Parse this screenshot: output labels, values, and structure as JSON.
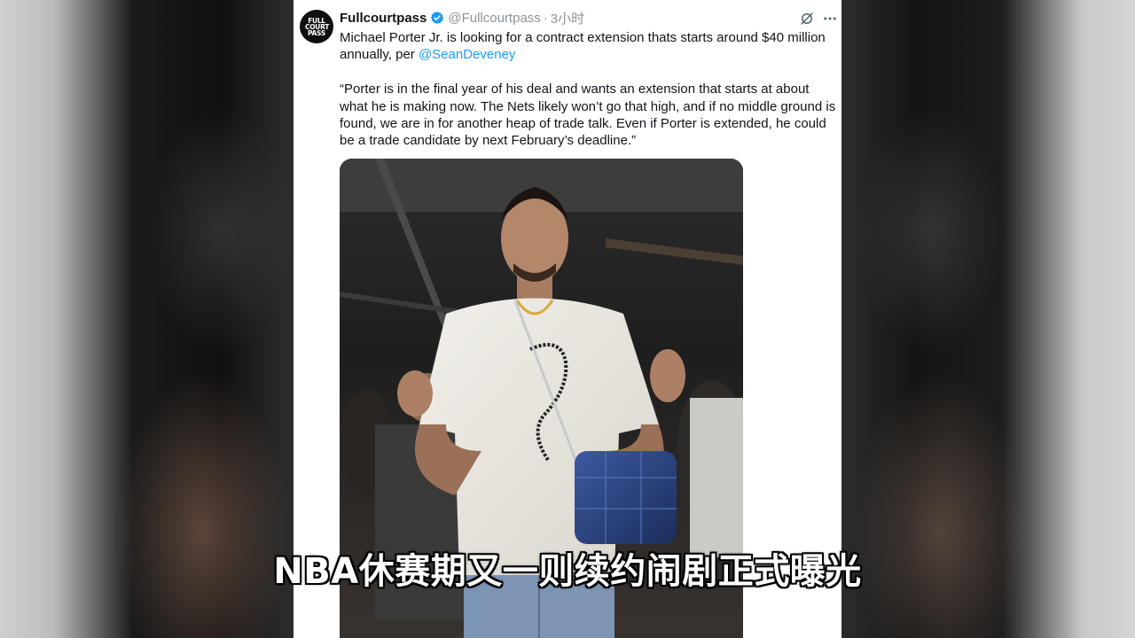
{
  "tweet": {
    "avatar_text": "FULL COURT PASS",
    "display_name": "Fullcourtpass",
    "handle": "@Fullcourtpass",
    "separator": "·",
    "time": "3小时",
    "text_line1": "Michael Porter Jr. is looking for a contract extension thats starts around $40 million annually, per ",
    "mention": "@SeanDeveney",
    "quote": "“Porter is in the final year of his deal and wants an extension that starts at about what he is making now. The Nets likely won’t go that high, and if no middle ground is found, we are in for another heap of trade talk. Even if Porter is extended, he could be a trade candidate by next February’s deadline.”",
    "accent_color": "#1d9bf0",
    "verified_color": "#1d9bf0"
  },
  "icons": {
    "verified": "verified-badge-icon",
    "grok": "grok-icon",
    "more": "more-icon"
  },
  "subtitle": "NBA休赛期又一则续约闹剧正式曝光"
}
